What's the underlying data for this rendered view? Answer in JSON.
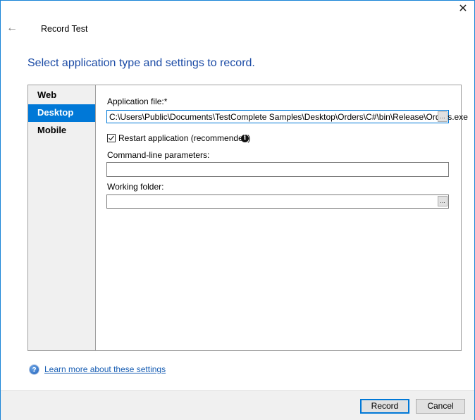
{
  "window": {
    "title": "Record Test",
    "close_icon": "close-icon",
    "back_icon": "back-arrow-icon"
  },
  "heading": "Select application type and settings to record.",
  "sidebar": {
    "items": [
      {
        "label": "Web",
        "active": false
      },
      {
        "label": "Desktop",
        "active": true
      },
      {
        "label": "Mobile",
        "active": false
      }
    ]
  },
  "form": {
    "app_file_label": "Application file:*",
    "app_file_value": "C:\\Users\\Public\\Documents\\TestComplete Samples\\Desktop\\Orders\\C#\\bin\\Release\\Orders.exe",
    "browse_label": "...",
    "restart_label": "Restart application (recommended)",
    "restart_checked": true,
    "info_glyph": "i",
    "cmdline_label": "Command-line parameters:",
    "cmdline_value": "",
    "workdir_label": "Working folder:",
    "workdir_value": ""
  },
  "help": {
    "glyph": "?",
    "link_text": "Learn more about these settings"
  },
  "footer": {
    "record_label": "Record",
    "cancel_label": "Cancel"
  },
  "colors": {
    "accent": "#0078d7",
    "heading": "#1a4aa5",
    "link": "#1a5fb4"
  }
}
